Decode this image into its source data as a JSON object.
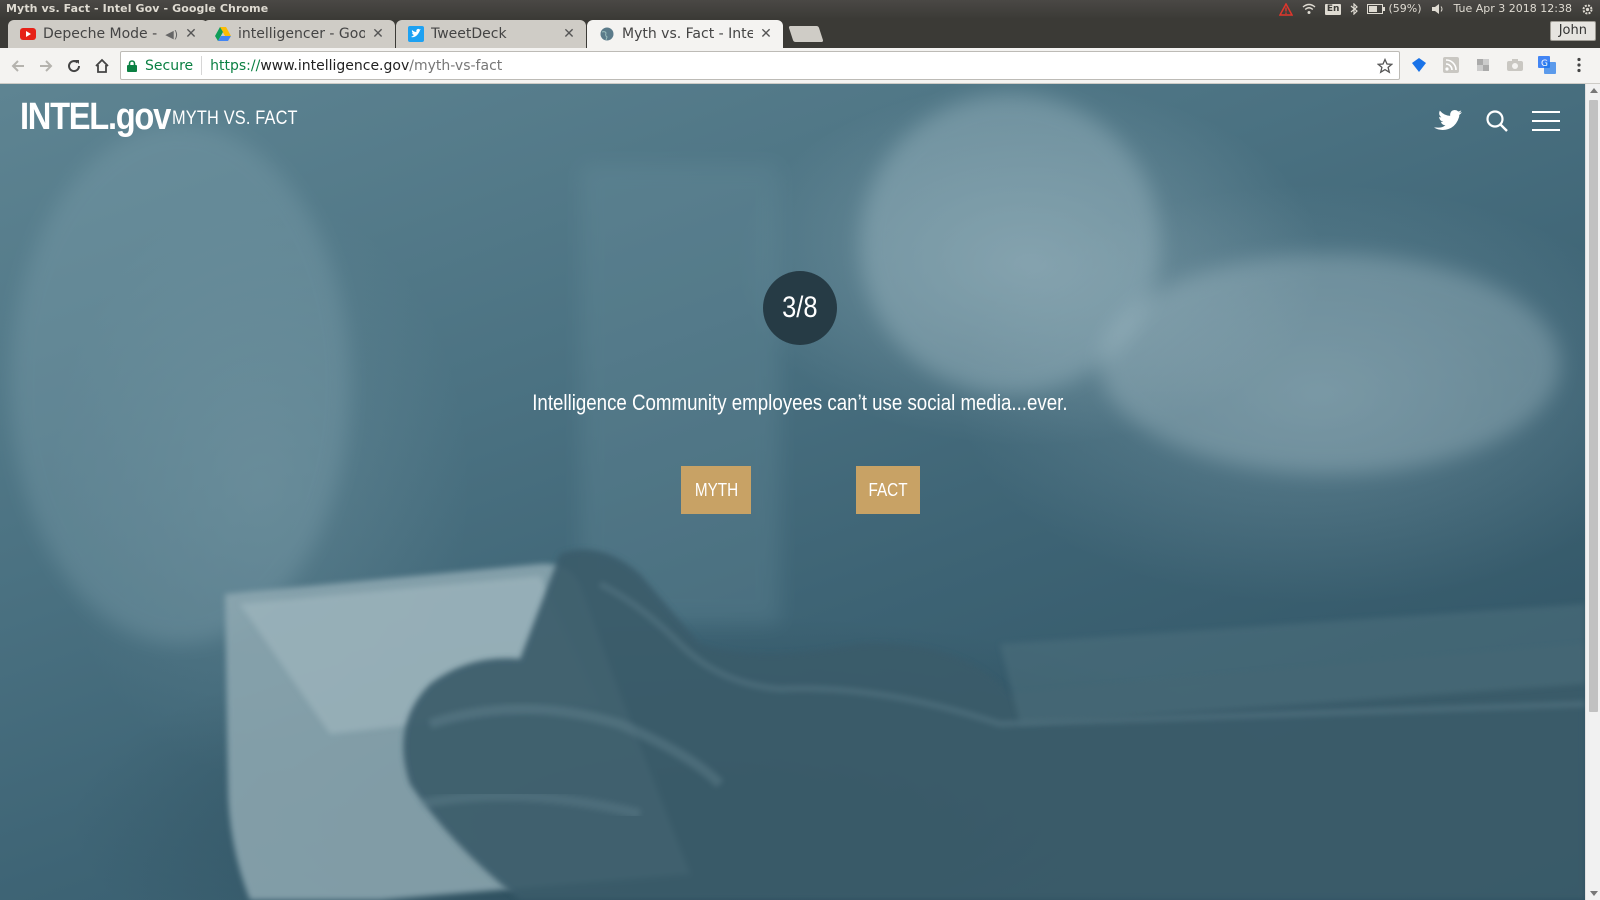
{
  "os": {
    "window_title": "Myth vs. Fact - Intel Gov - Google Chrome",
    "battery": "(59%)",
    "keyboard_lang": "En",
    "datetime": "Tue Apr 3 2018 12:38"
  },
  "browser": {
    "tabs": [
      {
        "label": "Depeche Mode - ",
        "favicon": "youtube-icon",
        "audio": true
      },
      {
        "label": "intelligencer - Goog",
        "favicon": "google-drive-icon"
      },
      {
        "label": "TweetDeck",
        "favicon": "tweetdeck-icon"
      },
      {
        "label": "Myth vs. Fact - Intel",
        "favicon": "globe-icon",
        "active": true
      }
    ],
    "profile_name": "John",
    "secure_label": "Secure",
    "url_scheme": "https://",
    "url_host": "www.intelligence.gov",
    "url_path": "/myth-vs-fact"
  },
  "site": {
    "logo": "INTEL.gov",
    "section_title": "MYTH VS. FACT",
    "counter": "3/8",
    "statement": "Intelligence Community employees can’t use social media...ever.",
    "buttons": {
      "myth": "MYTH",
      "fact": "FACT"
    },
    "accent_color": "#c8a265"
  }
}
